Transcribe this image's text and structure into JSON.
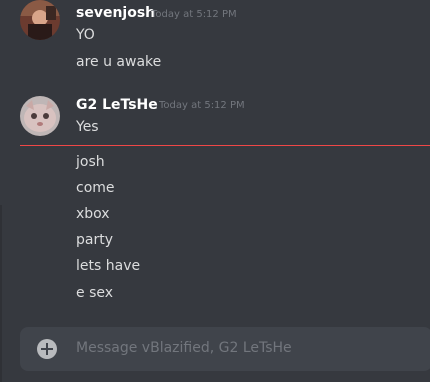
{
  "messages": [
    {
      "author": "sevenjosh",
      "timestamp": "Today at 5:12 PM",
      "lines": [
        "YO",
        "are u awake"
      ]
    },
    {
      "author": "G2 LeTsHe",
      "timestamp": "Today at 5:12 PM",
      "lines": [
        "Yes"
      ]
    }
  ],
  "new_messages": [
    "josh",
    "come",
    "xbox",
    "party",
    "lets have",
    "e sex"
  ],
  "composer": {
    "placeholder": "Message vBlazified, G2 LeTsHe",
    "add_icon": "plus-circle-icon"
  },
  "colors": {
    "background": "#36393f",
    "input": "#40444b",
    "new_messages_divider": "#f04747",
    "username": "#ffffff",
    "text": "#dcddde",
    "muted": "#72767d"
  }
}
